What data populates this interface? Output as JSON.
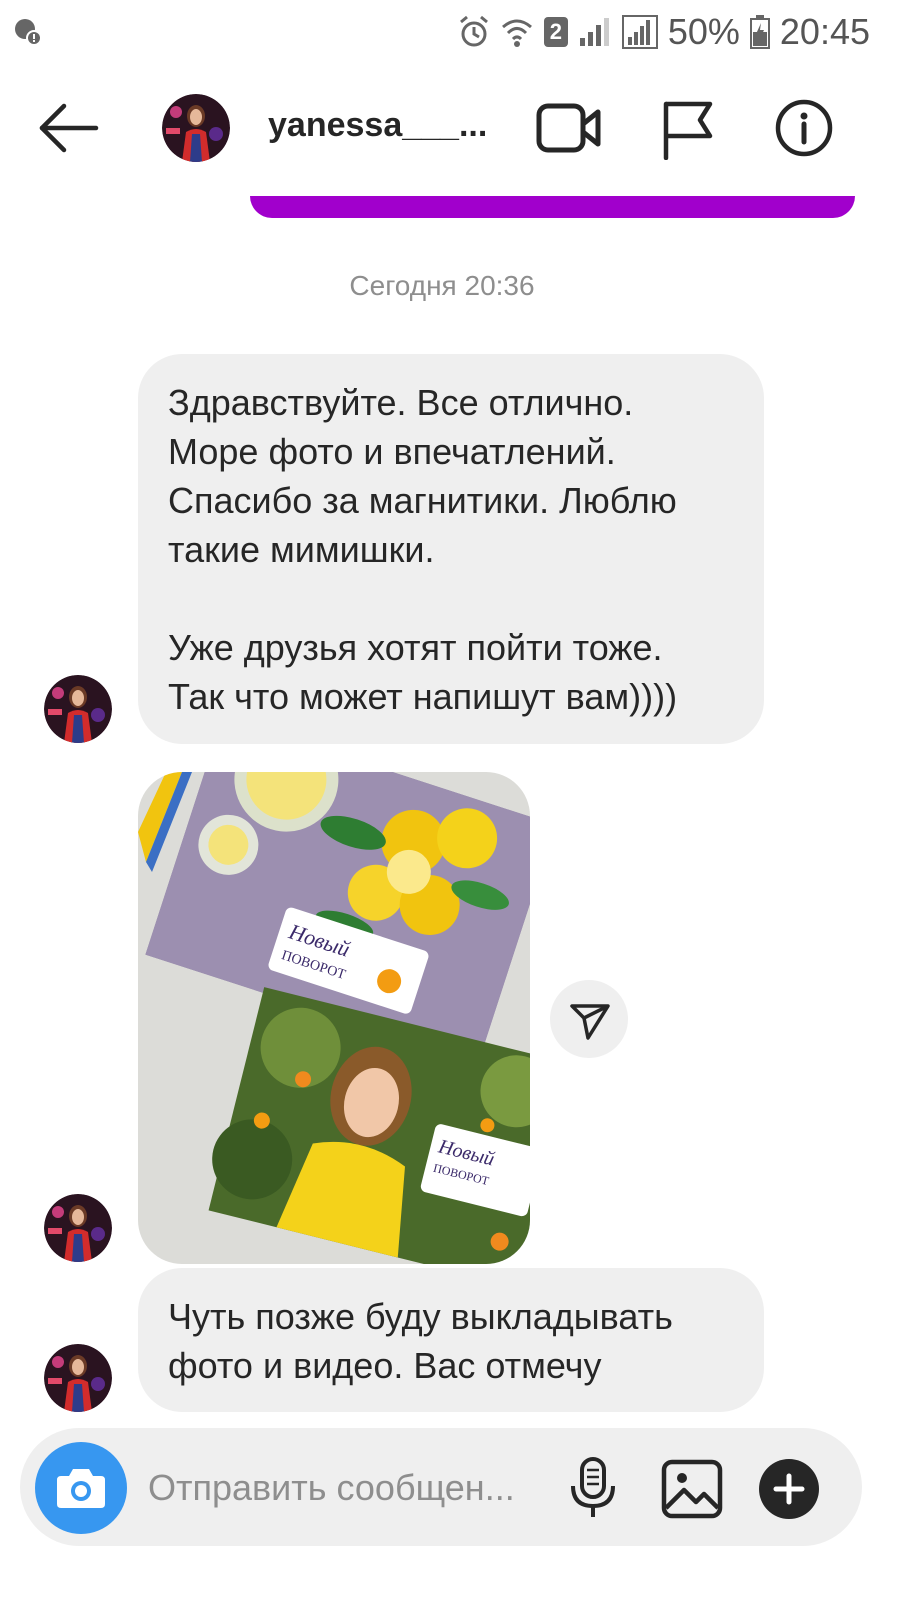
{
  "status_bar": {
    "battery": "50%",
    "time": "20:45",
    "sim_badge": "2",
    "icons": [
      "location-icon",
      "alarm-icon",
      "wifi-icon",
      "signal-icon",
      "signal-icon-2",
      "battery-icon"
    ]
  },
  "header": {
    "username": "yanessa___...",
    "icons": [
      "back-arrow-icon",
      "avatar",
      "video-call-icon",
      "flag-icon",
      "info-icon"
    ]
  },
  "thread": {
    "timestamp": "Сегодня 20:36",
    "messages": [
      {
        "type": "text",
        "text": "Здравствуйте. Все отлично.\nМоре фото и впечатлений.\nСпасибо за магнитики. Люблю\nтакие мимишки.\n\nУже друзья хотят пойти тоже.\nТак что может напишут вам))))"
      },
      {
        "type": "photo",
        "brand": "Новый поворот"
      },
      {
        "type": "text",
        "text": "Чуть позже буду выкладывать\nфото и видео. Вас отмечу"
      }
    ]
  },
  "composer": {
    "placeholder": "Отправить сообщен...",
    "icons": [
      "camera-icon",
      "microphone-icon",
      "gallery-icon",
      "plus-icon"
    ]
  },
  "colors": {
    "accent_blue": "#3797f0",
    "purple_bubble": "#a100cc",
    "bubble_gray": "#efefef",
    "text_dark": "#262626",
    "text_gray": "#8e8e8e"
  }
}
